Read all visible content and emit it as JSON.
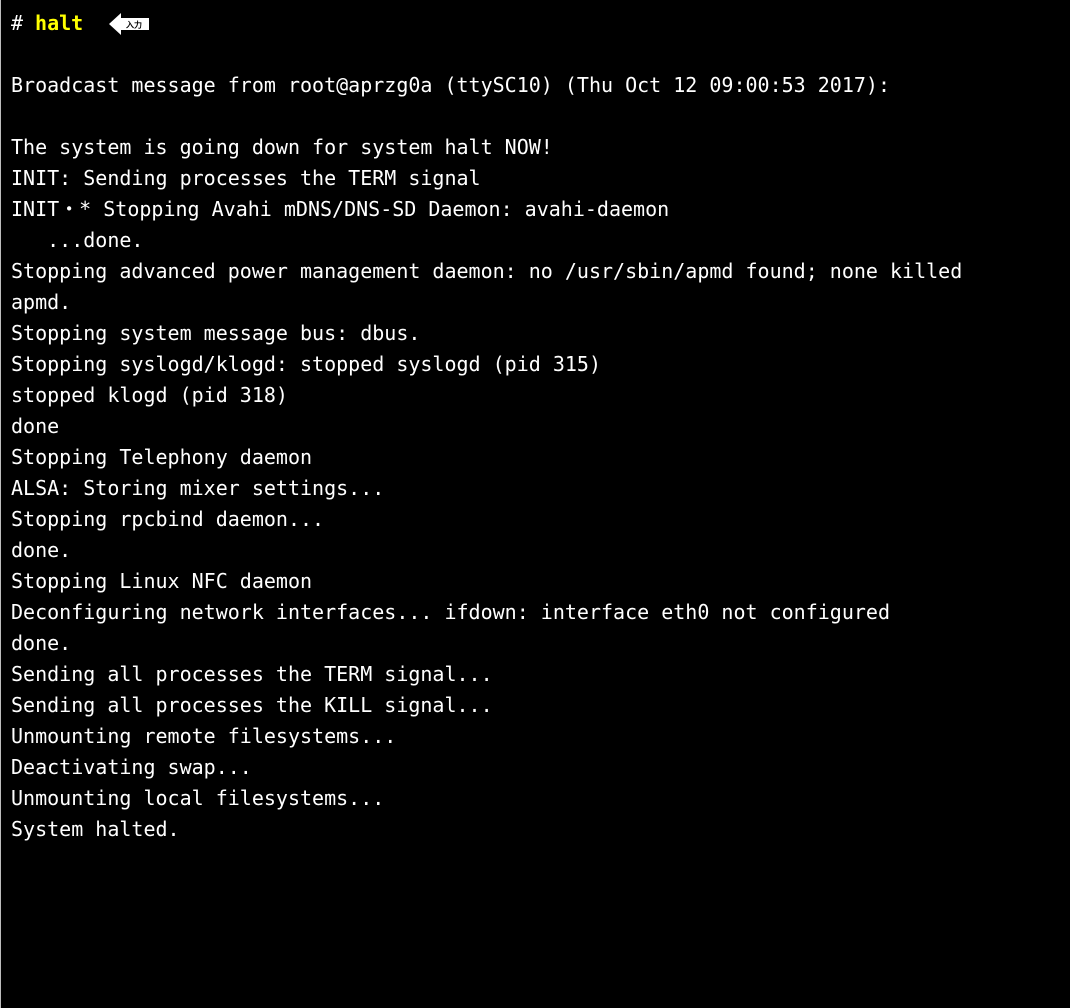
{
  "terminal": {
    "prompt_char": "#",
    "command": "halt",
    "enter_badge": {
      "icon": "enter-key-left-arrow-icon",
      "label": "入力",
      "color": "#ffffff"
    },
    "colors": {
      "background": "#000000",
      "text": "#ffffff",
      "command": "#ffff00"
    },
    "output_lines": [
      "",
      "Broadcast message from root@aprzg0a (ttySC10) (Thu Oct 12 09:00:53 2017):",
      "",
      "The system is going down for system halt NOW!",
      "INIT: Sending processes the TERM signal",
      "INIT・* Stopping Avahi mDNS/DNS-SD Daemon: avahi-daemon",
      "   ...done.",
      "Stopping advanced power management daemon: no /usr/sbin/apmd found; none killed",
      "apmd.",
      "Stopping system message bus: dbus.",
      "Stopping syslogd/klogd: stopped syslogd (pid 315)",
      "stopped klogd (pid 318)",
      "done",
      "Stopping Telephony daemon",
      "ALSA: Storing mixer settings...",
      "Stopping rpcbind daemon...",
      "done.",
      "Stopping Linux NFC daemon",
      "Deconfiguring network interfaces... ifdown: interface eth0 not configured",
      "done.",
      "Sending all processes the TERM signal...",
      "Sending all processes the KILL signal...",
      "Unmounting remote filesystems...",
      "Deactivating swap...",
      "Unmounting local filesystems...",
      "System halted."
    ]
  }
}
